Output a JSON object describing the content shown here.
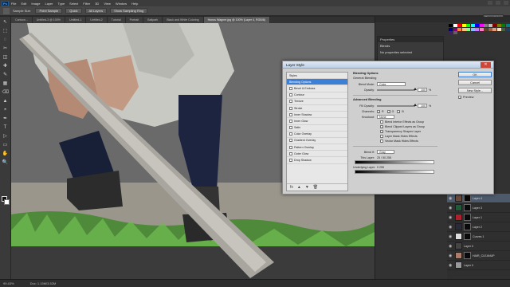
{
  "menubar": {
    "logo": "Ps",
    "items": [
      "File",
      "Edit",
      "Image",
      "Layer",
      "Type",
      "Select",
      "Filter",
      "3D",
      "View",
      "Window",
      "Help"
    ]
  },
  "options": {
    "label": "Sample Size",
    "value": "Point Sample",
    "btn1": "Quick",
    "btn2": "All Layers",
    "btn3": "Show Sampling Ring",
    "workspace": "Essentials"
  },
  "tabs": [
    {
      "label": "Cartoon...",
      "active": false
    },
    {
      "label": "Untitled-3 @ 100%",
      "active": false
    },
    {
      "label": "Untitled-1",
      "active": false
    },
    {
      "label": "Untitled-2",
      "active": false
    },
    {
      "label": "Tutorial",
      "active": false
    },
    {
      "label": "Portrait",
      "active": false
    },
    {
      "label": "Ballpark",
      "active": false
    },
    {
      "label": "Black and White Coloring",
      "active": false
    },
    {
      "label": "Honus Wagner.jpg @ 100% (Layer 4, RGB/8)",
      "active": true
    }
  ],
  "tools": [
    "↖",
    "⬚",
    "◌",
    "✂",
    "◫",
    "✚",
    "✎",
    "▦",
    "⌫",
    "▲",
    "◓",
    "✒",
    "T",
    "▷",
    "▭",
    "✋",
    "🔍"
  ],
  "properties": {
    "title": "Properties",
    "item": "Blends",
    "sub": "No properties selected"
  },
  "layer_style": {
    "title": "Layer Style",
    "styles": [
      {
        "label": "Styles",
        "checkbox": false,
        "checked": false,
        "selected": false
      },
      {
        "label": "Blending Options",
        "checkbox": false,
        "checked": false,
        "selected": true
      },
      {
        "label": "Bevel & Emboss",
        "checkbox": true,
        "checked": false,
        "selected": false
      },
      {
        "label": "Contour",
        "checkbox": true,
        "checked": false,
        "selected": false
      },
      {
        "label": "Texture",
        "checkbox": true,
        "checked": false,
        "selected": false
      },
      {
        "label": "Stroke",
        "checkbox": true,
        "checked": false,
        "selected": false
      },
      {
        "label": "Inner Shadow",
        "checkbox": true,
        "checked": false,
        "selected": false
      },
      {
        "label": "Inner Glow",
        "checkbox": true,
        "checked": false,
        "selected": false
      },
      {
        "label": "Satin",
        "checkbox": true,
        "checked": false,
        "selected": false
      },
      {
        "label": "Color Overlay",
        "checkbox": true,
        "checked": false,
        "selected": false
      },
      {
        "label": "Gradient Overlay",
        "checkbox": true,
        "checked": false,
        "selected": false
      },
      {
        "label": "Pattern Overlay",
        "checkbox": true,
        "checked": false,
        "selected": false
      },
      {
        "label": "Outer Glow",
        "checkbox": true,
        "checked": false,
        "selected": false
      },
      {
        "label": "Drop Shadow",
        "checkbox": true,
        "checked": false,
        "selected": false
      }
    ],
    "general_title": "Blending Options",
    "general_sub": "General Blending",
    "blend_mode_label": "Blend Mode:",
    "blend_mode_value": "Color",
    "opacity_label": "Opacity:",
    "opacity_value": "100",
    "opacity_fraction": 1.0,
    "advanced_title": "Advanced Blending",
    "fill_label": "Fill Opacity:",
    "fill_value": "100",
    "fill_fraction": 1.0,
    "channels_label": "Channels:",
    "channels": [
      "R",
      "G",
      "B"
    ],
    "knockout_label": "Knockout:",
    "knockout_value": "None",
    "checks": [
      {
        "label": "Blend Interior Effects as Group",
        "checked": false
      },
      {
        "label": "Blend Clipped Layers as Group",
        "checked": true
      },
      {
        "label": "Transparency Shapes Layer",
        "checked": true
      },
      {
        "label": "Layer Mask Hides Effects",
        "checked": false
      },
      {
        "label": "Vector Mask Hides Effects",
        "checked": false
      }
    ],
    "blend_if_label": "Blend If:",
    "blend_if_value": "Gray",
    "this_layer_label": "This Layer:",
    "this_layer_values": "25  /  50    255",
    "underlying_label": "Underlying Layer:",
    "underlying_values": "0     255",
    "units": "%",
    "buttons": {
      "ok": "OK",
      "cancel": "Cancel",
      "new_style": "New Style...",
      "preview": "Preview"
    },
    "preview_checked": true,
    "footer_icons": [
      "fx",
      "▲",
      "▼",
      "🗑"
    ]
  },
  "layers": [
    {
      "name": "Layer 4",
      "thumb": "#6b4a3a",
      "selected": true,
      "mask": true
    },
    {
      "name": "Layer 3",
      "thumb": "#1f5a3a",
      "selected": false,
      "mask": true
    },
    {
      "name": "Layer 1",
      "thumb": "#b0202a",
      "selected": false,
      "mask": true
    },
    {
      "name": "Layer 2",
      "thumb": "#2a2a3a",
      "selected": false,
      "mask": true
    },
    {
      "name": "Curves 1",
      "thumb": "#dddddd",
      "selected": false,
      "mask": true
    },
    {
      "name": "Layer 0",
      "thumb": "#444444",
      "selected": false,
      "mask": false
    },
    {
      "name": "HAIR_CLEANUP",
      "thumb": "#b07a6a",
      "selected": false,
      "mask": true
    },
    {
      "name": "Layer 0",
      "thumb": "#999999",
      "selected": false,
      "mask": false
    }
  ],
  "status": {
    "zoom": "99.43%",
    "doc": "Doc: 1.15M/3.52M"
  },
  "colors": {
    "accent": "#3c7fd6",
    "swatches": [
      "#000000",
      "#ffffff",
      "#ff0000",
      "#ffff00",
      "#00ff00",
      "#00ffff",
      "#0000ff",
      "#ff00ff",
      "#808080",
      "#c0c0c0",
      "#800000",
      "#808000",
      "#008000",
      "#008080",
      "#000080",
      "#800080",
      "#ff8040",
      "#ffc080",
      "#80ff80",
      "#80c0ff",
      "#c080ff",
      "#ff80c0",
      "#604020",
      "#a06040",
      "#e0a080",
      "#ffe0c0",
      "#406040",
      "#204060",
      "#402060",
      "#606060"
    ]
  }
}
